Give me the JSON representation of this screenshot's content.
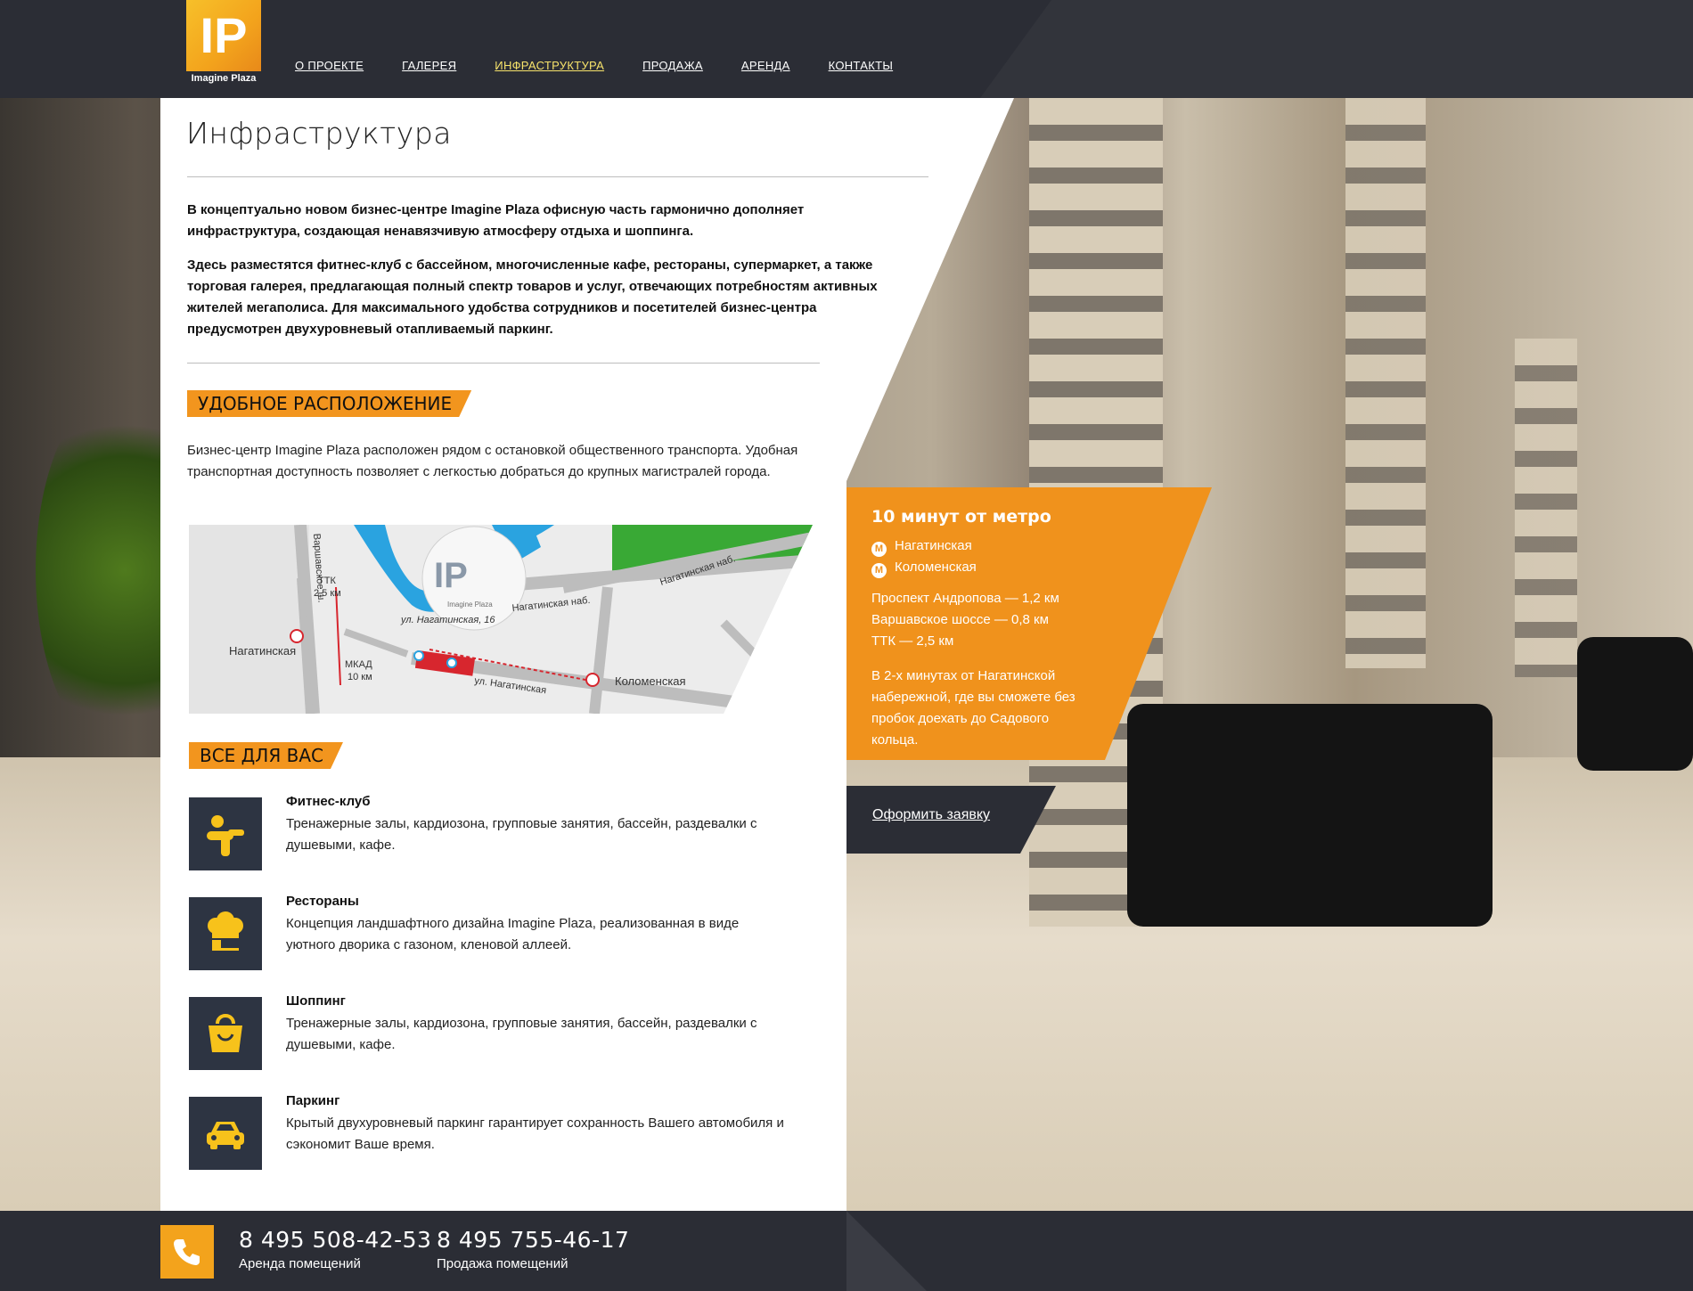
{
  "brand": {
    "logo_mark": "IP",
    "name": "Imagine Plaza"
  },
  "nav": [
    {
      "label": "О ПРОЕКТЕ",
      "active": false
    },
    {
      "label": "ГАЛЕРЕЯ",
      "active": false
    },
    {
      "label": "ИНФРАСТРУКТУРА",
      "active": true
    },
    {
      "label": "ПРОДАЖА",
      "active": false
    },
    {
      "label": "АРЕНДА",
      "active": false
    },
    {
      "label": "КОНТАКТЫ",
      "active": false
    }
  ],
  "page": {
    "title": "Инфраструктура",
    "lead_1": "В концептуально новом бизнес-центре Imagine Plaza офисную часть гармонично дополняет инфраструктура, создающая ненавязчивую атмосферу отдыха и шоппинга.",
    "lead_2": "Здесь разместятся фитнес-клуб с бассейном, многочисленные кафе, рестораны, супермаркет, а также торговая галерея, предлагающая полный спектр товаров и услуг, отвечающих потребностям активных жителей мегаполиса. Для максимального удобства сотрудников и посетителей бизнес-центра предусмотрен двухуровневый отапливаемый паркинг."
  },
  "location": {
    "heading": "УДОБНОЕ РАСПОЛОЖЕНИЕ",
    "text": "Бизнес-центр Imagine Plaza расположен рядом с остановкой общественного транспорта. Удобная транспортная доступность позволяет с легкостью добраться до крупных магистралей города."
  },
  "map": {
    "labels": {
      "varshavskoe": "Варшавское ш.",
      "ttk": "ТТК",
      "ttk_dist": "2,5 км",
      "mkad": "МКАД",
      "mkad_dist": "10 км",
      "nagatinskaya": "Нагатинская",
      "kolomenskaya": "Коломенская",
      "nab_1": "Нагатинская наб.",
      "nab_2": "Нагатинская наб.",
      "street": "ул. Нагатинская",
      "address": "ул. Нагатинская, 16",
      "logo_name": "Imagine Plaza"
    }
  },
  "features": {
    "heading": "ВСЕ ДЛЯ ВАС",
    "items": [
      {
        "title": "Фитнес-клуб",
        "text": "Тренажерные залы, кардиозона, групповые занятия, бассейн, раздевалки с душевыми, кафе.",
        "icon": "fitness-icon"
      },
      {
        "title": "Рестораны",
        "text": "Концепция ландшафтного дизайна Imagine Plaza, реализованная в виде уютного дворика с газоном, кленовой аллеей.",
        "icon": "chef-hat-icon"
      },
      {
        "title": "Шоппинг",
        "text": "Тренажерные залы, кардиозона, групповые занятия, бассейн, раздевалки с душевыми, кафе.",
        "icon": "shopping-bag-icon"
      },
      {
        "title": "Паркинг",
        "text": "Крытый двухуровневый паркинг гарантирует сохранность Вашего автомобиля и сэкономит Ваше время.",
        "icon": "car-icon"
      }
    ]
  },
  "metro_box": {
    "title": "10 минут от метро",
    "stations": [
      "Нагатинская",
      "Коломенская"
    ],
    "metro_symbol": "М",
    "distances": "Проспект Андропова — 1,2 км Варшавское шоссе — 0,8 км ТТК — 2,5 км",
    "distance_lines": [
      "Проспект Андропова — 1,2 км",
      "Варшавское шоссе — 0,8 км",
      "ТТК — 2,5 км"
    ],
    "note": "В 2-х минутах от Нагатинской набережной, где вы сможете без пробок доехать до Садового кольца."
  },
  "apply": {
    "label": "Оформить заявку"
  },
  "footer": {
    "phones": [
      {
        "number": "8 495 508-42-53",
        "label": "Аренда помещений"
      },
      {
        "number": "8 495 755-46-17",
        "label": "Продажа помещений"
      }
    ]
  },
  "colors": {
    "accent": "#f0921c",
    "dark": "#2b2d35",
    "nav_active": "#f7e36b",
    "icon_tile": "#2d3442"
  }
}
